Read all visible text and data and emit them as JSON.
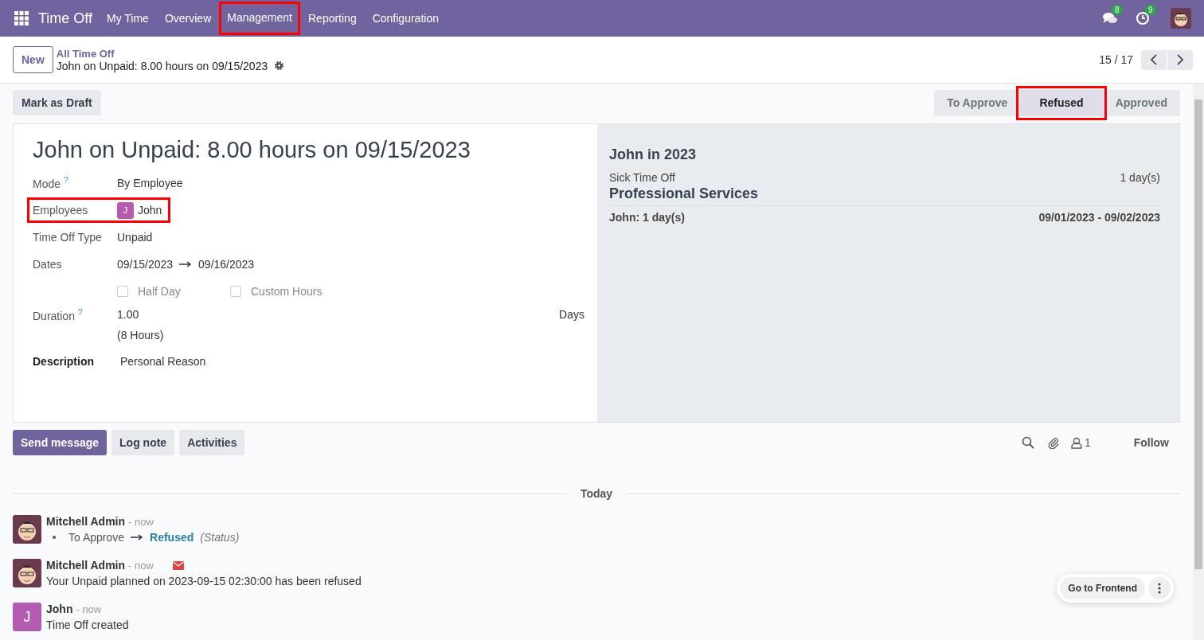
{
  "navbar": {
    "app_name": "Time Off",
    "menu": [
      {
        "label": "My Time",
        "highlighted": false
      },
      {
        "label": "Overview",
        "highlighted": false
      },
      {
        "label": "Management",
        "highlighted": true
      },
      {
        "label": "Reporting",
        "highlighted": false
      },
      {
        "label": "Configuration",
        "highlighted": false
      }
    ],
    "messages_count": "8",
    "activities_count": "9"
  },
  "control_panel": {
    "new_button": "New",
    "breadcrumb": "All Time Off",
    "record_title": "John on Unpaid: 8.00 hours on 09/15/2023",
    "pager": "15 / 17"
  },
  "status_bar": {
    "action_button": "Mark as Draft",
    "stages": [
      {
        "label": "To Approve",
        "selected": false,
        "highlighted": false
      },
      {
        "label": "Refused",
        "selected": true,
        "highlighted": true
      },
      {
        "label": "Approved",
        "selected": false,
        "highlighted": false
      }
    ]
  },
  "form": {
    "title": "John on Unpaid: 8.00 hours on 09/15/2023",
    "mode": {
      "label": "Mode",
      "help": "?",
      "value": "By Employee"
    },
    "employees": {
      "label": "Employees",
      "highlighted": true,
      "tags": [
        {
          "initial": "J",
          "name": "John",
          "color": "#b45cb1"
        }
      ]
    },
    "time_off_type": {
      "label": "Time Off Type",
      "value": "Unpaid"
    },
    "dates": {
      "label": "Dates",
      "from": "09/15/2023",
      "to": "09/16/2023"
    },
    "options": [
      {
        "label": "Half Day",
        "checked": false
      },
      {
        "label": "Custom Hours",
        "checked": false
      }
    ],
    "duration": {
      "label": "Duration",
      "help": "?",
      "value": "1.00",
      "unit": "Days",
      "hours": "(8 Hours)"
    },
    "description": {
      "label": "Description",
      "value": "Personal Reason"
    }
  },
  "summary": {
    "title": "John in 2023",
    "rows": [
      {
        "label": "Sick Time Off",
        "value": "1 day(s)"
      }
    ],
    "section_title": "Professional Services",
    "section_rows": [
      {
        "label": "John: 1 day(s)",
        "value": "09/01/2023 - 09/02/2023"
      }
    ]
  },
  "chatter": {
    "buttons": [
      {
        "label": "Send message",
        "primary": true
      },
      {
        "label": "Log note",
        "primary": false
      },
      {
        "label": "Activities",
        "primary": false
      }
    ],
    "follower_count": "1",
    "follow": "Follow",
    "date_separator": "Today",
    "messages": [
      {
        "author": "Mitchell Admin",
        "time": "- now",
        "kind": "admin",
        "email": false,
        "tracking": {
          "old": "To Approve",
          "new": "Refused",
          "field": "(Status)"
        }
      },
      {
        "author": "Mitchell Admin",
        "time": "- now",
        "kind": "admin",
        "email": true,
        "body": "Your Unpaid planned on 2023-09-15 02:30:00 has been refused"
      },
      {
        "author": "John",
        "time": "- now",
        "kind": "initial",
        "initial": "J",
        "color": "#b45cb1",
        "email": false,
        "body": "Time Off created"
      }
    ]
  },
  "frontend_button": "Go to Frontend"
}
